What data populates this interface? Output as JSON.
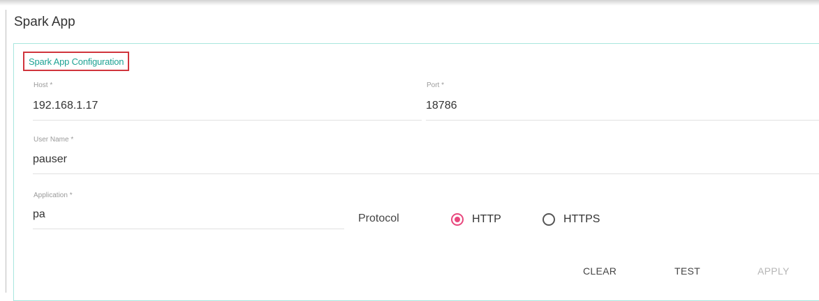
{
  "page": {
    "title": "Spark App"
  },
  "config": {
    "section_title": "Spark App Configuration",
    "fields": {
      "host": {
        "label": "Host *",
        "value": "192.168.1.17"
      },
      "port": {
        "label": "Port *",
        "value": "18786"
      },
      "user_name": {
        "label": "User Name *",
        "value": "pauser"
      },
      "application": {
        "label": "Application *",
        "value": "pa"
      }
    },
    "protocol": {
      "label": "Protocol",
      "options": [
        {
          "label": "HTTP",
          "checked": true
        },
        {
          "label": "HTTPS",
          "checked": false
        }
      ]
    }
  },
  "actions": {
    "clear": "CLEAR",
    "test": "TEST",
    "apply": "APPLY",
    "apply_disabled": true
  },
  "colors": {
    "accent": "#1fa394",
    "radio_selected": "#e8477d",
    "highlight_box": "#d0343c",
    "panel_border": "#a8e6de"
  }
}
